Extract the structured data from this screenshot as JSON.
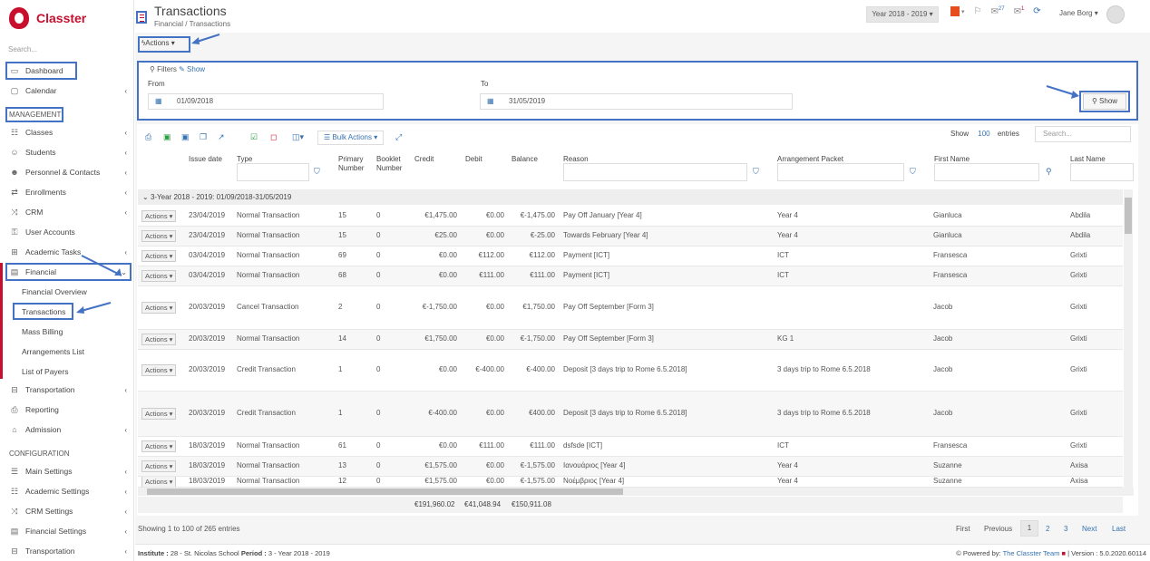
{
  "app": {
    "brand": "Classter",
    "accent": "#c8102e",
    "highlight": "#4472c4"
  },
  "sidebar": {
    "search_placeholder": "Search...",
    "items": [
      {
        "label": "Dashboard",
        "icon": "laptop-icon",
        "chevron": false
      },
      {
        "label": "Calendar",
        "icon": "calendar-icon",
        "chevron": true
      },
      {
        "label": "Classes",
        "icon": "classes-icon",
        "chevron": true
      },
      {
        "label": "Students",
        "icon": "students-icon",
        "chevron": true
      },
      {
        "label": "Personnel & Contacts",
        "icon": "personnel-icon",
        "chevron": true
      },
      {
        "label": "Enrollments",
        "icon": "exchange-icon",
        "chevron": true
      },
      {
        "label": "CRM",
        "icon": "shuffle-icon",
        "chevron": true
      },
      {
        "label": "User Accounts",
        "icon": "key-icon",
        "chevron": false
      },
      {
        "label": "Academic Tasks",
        "icon": "table-icon",
        "chevron": true
      },
      {
        "label": "Financial",
        "icon": "money-icon",
        "chevron": true
      },
      {
        "label": "Transportation",
        "icon": "bus-icon",
        "chevron": true
      },
      {
        "label": "Reporting",
        "icon": "print-icon",
        "chevron": false
      },
      {
        "label": "Admission",
        "icon": "bank-icon",
        "chevron": true
      }
    ],
    "management_label": "MANAGEMENT",
    "configuration_label": "CONFIGURATION",
    "financial_sub": [
      "Financial Overview",
      "Transactions",
      "Mass Billing",
      "Arrangements List",
      "List of Payers"
    ],
    "config_items": [
      {
        "label": "Main Settings",
        "icon": "sliders-icon"
      },
      {
        "label": "Academic Settings",
        "icon": "classes-icon"
      },
      {
        "label": "CRM Settings",
        "icon": "shuffle-icon"
      },
      {
        "label": "Financial Settings",
        "icon": "money-icon"
      },
      {
        "label": "Transportation",
        "icon": "bus-icon"
      }
    ]
  },
  "header": {
    "title": "Transactions",
    "breadcrumb_parent": "Financial",
    "breadcrumb_sep": "/",
    "breadcrumb_current": "Transactions",
    "year_selector": "Year 2018 - 2019",
    "badge_messages": "27",
    "badge_notifications": "1",
    "user_name": "Jane Borg"
  },
  "toolbar": {
    "actions_label": "Actions"
  },
  "filters": {
    "title": "Filters",
    "show_link": "Show",
    "from_label": "From",
    "from_value": "01/09/2018",
    "to_label": "To",
    "to_value": "31/05/2019",
    "show_button": "Show"
  },
  "table": {
    "bulk_actions": "Bulk Actions",
    "show_label": "Show",
    "entries_count": "100",
    "entries_label": "entries",
    "search_placeholder": "Search...",
    "columns": [
      "Issue date",
      "Type",
      "Primary",
      "Number",
      "Booklet",
      "Number",
      "Credit",
      "Debit",
      "Balance",
      "Reason",
      "Arrangement Packet",
      "First Name",
      "Last Name"
    ],
    "group_label": "3-Year 2018 - 2019: 01/09/2018-31/05/2019",
    "action_label": "Actions",
    "rows": [
      {
        "date": "23/04/2019",
        "type": "Normal Transaction",
        "primary": "15",
        "booklet": "0",
        "credit": "€1,475.00",
        "debit": "€0.00",
        "balance": "€-1,475.00",
        "reason": "Pay Off January [Year 4]",
        "packet": "Year 4",
        "first": "Gianluca",
        "last": "Abdila"
      },
      {
        "date": "23/04/2019",
        "type": "Normal Transaction",
        "primary": "15",
        "booklet": "0",
        "credit": "€25.00",
        "debit": "€0.00",
        "balance": "€-25.00",
        "reason": "Towards February [Year 4]",
        "packet": "Year 4",
        "first": "Gianluca",
        "last": "Abdila"
      },
      {
        "date": "03/04/2019",
        "type": "Normal Transaction",
        "primary": "69",
        "booklet": "0",
        "credit": "€0.00",
        "debit": "€112.00",
        "balance": "€112.00",
        "reason": "Payment [ICT]",
        "packet": "ICT",
        "first": "Fransesca",
        "last": "Grixti"
      },
      {
        "date": "03/04/2019",
        "type": "Normal Transaction",
        "primary": "68",
        "booklet": "0",
        "credit": "€0.00",
        "debit": "€111.00",
        "balance": "€111.00",
        "reason": "Payment [ICT]",
        "packet": "ICT",
        "first": "Fransesca",
        "last": "Grixti"
      },
      {
        "date": "20/03/2019",
        "type": "Cancel Transaction",
        "primary": "2",
        "booklet": "0",
        "credit": "€-1,750.00",
        "debit": "€0.00",
        "balance": "€1,750.00",
        "reason": "Pay Off September [Form 3]",
        "packet": "",
        "first": "Jacob",
        "last": "Grixti"
      },
      {
        "date": "20/03/2019",
        "type": "Normal Transaction",
        "primary": "14",
        "booklet": "0",
        "credit": "€1,750.00",
        "debit": "€0.00",
        "balance": "€-1,750.00",
        "reason": "Pay Off September [Form 3]",
        "packet": "KG 1",
        "first": "Jacob",
        "last": "Grixti"
      },
      {
        "date": "20/03/2019",
        "type": "Credit Transaction",
        "primary": "1",
        "booklet": "0",
        "credit": "€0.00",
        "debit": "€-400.00",
        "balance": "€-400.00",
        "reason": "Deposit [3 days trip to Rome 6.5.2018]",
        "packet": "3 days trip to Rome 6.5.2018",
        "first": "Jacob",
        "last": "Grixti"
      },
      {
        "date": "20/03/2019",
        "type": "Credit Transaction",
        "primary": "1",
        "booklet": "0",
        "credit": "€-400.00",
        "debit": "€0.00",
        "balance": "€400.00",
        "reason": "Deposit [3 days trip to Rome 6.5.2018]",
        "packet": "3 days trip to Rome 6.5.2018",
        "first": "Jacob",
        "last": "Grixti"
      },
      {
        "date": "18/03/2019",
        "type": "Normal Transaction",
        "primary": "61",
        "booklet": "0",
        "credit": "€0.00",
        "debit": "€111.00",
        "balance": "€111.00",
        "reason": "dsfsde [ICT]",
        "packet": "ICT",
        "first": "Fransesca",
        "last": "Grixti"
      },
      {
        "date": "18/03/2019",
        "type": "Normal Transaction",
        "primary": "13",
        "booklet": "0",
        "credit": "€1,575.00",
        "debit": "€0.00",
        "balance": "€-1,575.00",
        "reason": "Ιανουάριος [Year 4]",
        "packet": "Year 4",
        "first": "Suzanne",
        "last": "Axisa"
      },
      {
        "date": "18/03/2019",
        "type": "Normal Transaction",
        "primary": "12",
        "booklet": "0",
        "credit": "€1,575.00",
        "debit": "€0.00",
        "balance": "€-1,575.00",
        "reason": "Νοέμβριος [Year 4]",
        "packet": "Year 4",
        "first": "Suzanne",
        "last": "Axisa"
      }
    ],
    "totals": {
      "credit": "€191,960.02",
      "debit": "€41,048.94",
      "balance": "€150,911.08"
    },
    "info": "Showing 1 to 100 of 265 entries",
    "pager": {
      "first": "First",
      "previous": "Previous",
      "pages": [
        "1",
        "2",
        "3"
      ],
      "next": "Next",
      "last": "Last"
    }
  },
  "status": {
    "institute_label": "Institute :",
    "institute_value": "28 - St. Nicolas School",
    "period_label": "Period :",
    "period_value": "3 - Year 2018 - 2019",
    "powered_label": "Powered by:",
    "powered_team": "The Classter Team",
    "version": "| Version : 5.0.2020.60114"
  }
}
